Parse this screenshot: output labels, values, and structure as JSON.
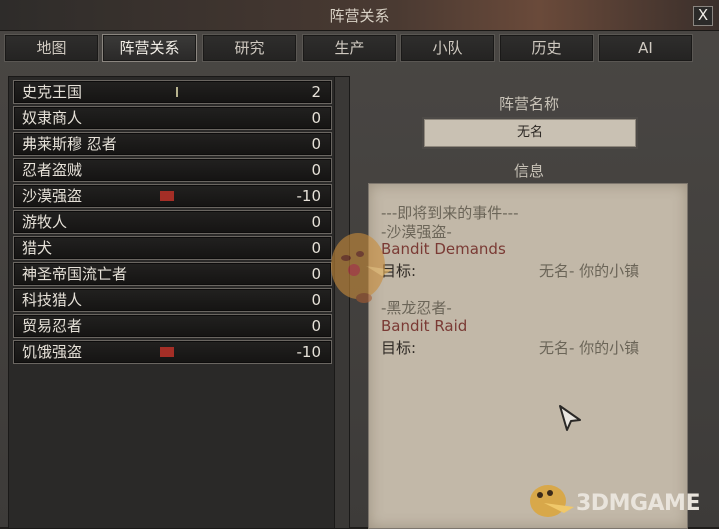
{
  "window": {
    "title": "阵营关系",
    "close_label": "X"
  },
  "tabs": [
    {
      "label": "地图",
      "active": false
    },
    {
      "label": "阵营关系",
      "active": true
    },
    {
      "label": "研究",
      "active": false
    },
    {
      "label": "生产",
      "active": false
    },
    {
      "label": "小队",
      "active": false
    },
    {
      "label": "历史",
      "active": false
    },
    {
      "label": "AI",
      "active": false
    }
  ],
  "factions": [
    {
      "name": "史克王国",
      "value": "2",
      "bar": "positive"
    },
    {
      "name": "奴隶商人",
      "value": "0",
      "bar": "none"
    },
    {
      "name": "弗莱斯穆 忍者",
      "value": "0",
      "bar": "none"
    },
    {
      "name": "忍者盗贼",
      "value": "0",
      "bar": "none"
    },
    {
      "name": "沙漠强盗",
      "value": "-10",
      "bar": "negative"
    },
    {
      "name": "游牧人",
      "value": "0",
      "bar": "none"
    },
    {
      "name": "猎犬",
      "value": "0",
      "bar": "none"
    },
    {
      "name": "神圣帝国流亡者",
      "value": "0",
      "bar": "none"
    },
    {
      "name": "科技猎人",
      "value": "0",
      "bar": "none"
    },
    {
      "name": "贸易忍者",
      "value": "0",
      "bar": "none"
    },
    {
      "name": "饥饿强盗",
      "value": "-10",
      "bar": "negative"
    }
  ],
  "right": {
    "faction_name_label": "阵营名称",
    "faction_name_value": "无名",
    "info_label": "信息",
    "upcoming_header": "---即将到来的事件---",
    "events": [
      {
        "faction": "-沙漠强盗-",
        "event": "Bandit Demands",
        "target_label": "目标:",
        "target_value": "无名- 你的小镇"
      },
      {
        "faction": "-黑龙忍者-",
        "event": "Bandit Raid",
        "target_label": "目标:",
        "target_value": "无名- 你的小镇"
      }
    ]
  },
  "watermark": {
    "text": "3DMGAME"
  },
  "colors": {
    "negative_bar": "#a42e26",
    "positive_bar": "#b7b38e",
    "parchment": "#c2b8a8",
    "event_name": "#7a3a34"
  }
}
